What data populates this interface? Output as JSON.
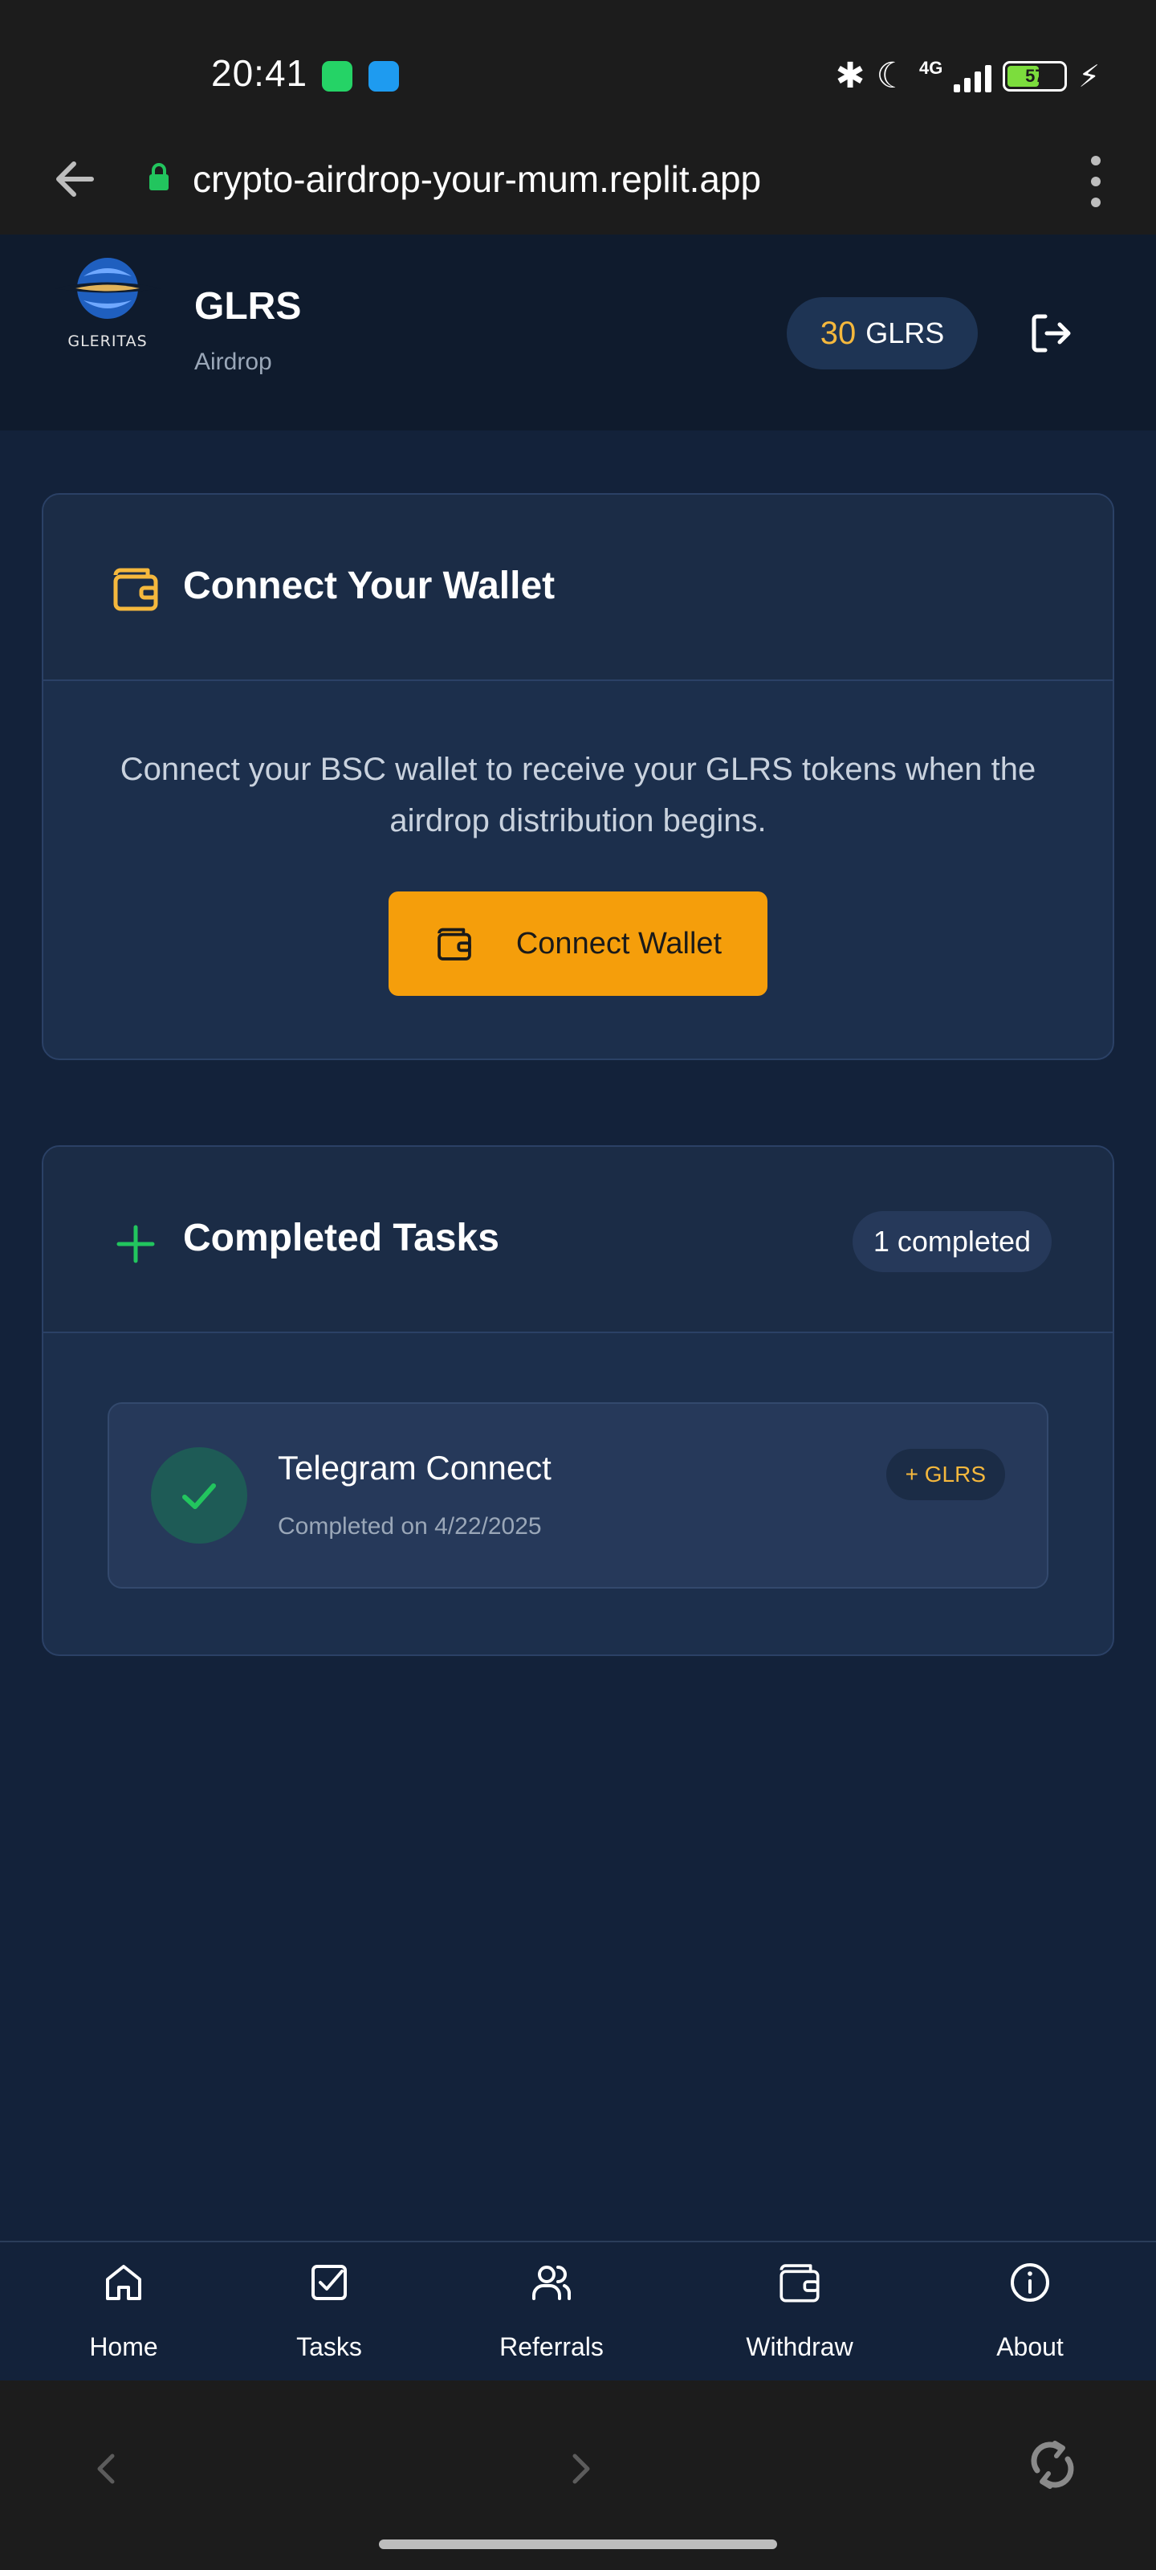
{
  "status_bar": {
    "time": "20:41",
    "apps": [
      "whatsapp-icon",
      "messages-icon"
    ],
    "network": "4G",
    "battery": "57"
  },
  "browser": {
    "url": "crypto-airdrop-your-mum.replit.app"
  },
  "header": {
    "logo_text": "GLERITAS",
    "brand": "GLRS",
    "subtitle": "Airdrop",
    "balance_amount": "30",
    "balance_unit": "GLRS"
  },
  "wallet_card": {
    "title": "Connect Your Wallet",
    "description": "Connect your BSC wallet to receive your GLRS tokens when the airdrop distribution begins.",
    "button_label": "Connect Wallet"
  },
  "tasks_card": {
    "title": "Completed Tasks",
    "badge": "1 completed",
    "items": [
      {
        "name": "Telegram Connect",
        "date": "Completed on 4/22/2025",
        "reward": "+ GLRS"
      }
    ]
  },
  "bottom_nav": {
    "items": [
      {
        "label": "Home",
        "icon": "home-icon"
      },
      {
        "label": "Tasks",
        "icon": "tasks-icon"
      },
      {
        "label": "Referrals",
        "icon": "referrals-icon"
      },
      {
        "label": "Withdraw",
        "icon": "wallet-icon"
      },
      {
        "label": "About",
        "icon": "info-icon"
      }
    ]
  },
  "colors": {
    "accent": "#f59e0b",
    "balance": "#f5b83d",
    "success": "#22c55e",
    "background": "#13223a"
  }
}
